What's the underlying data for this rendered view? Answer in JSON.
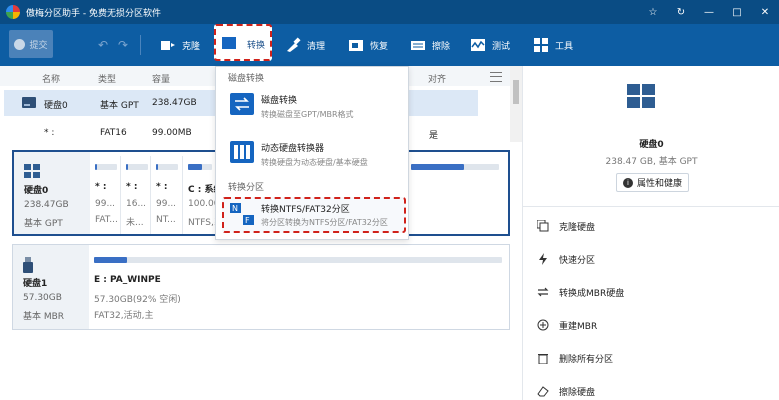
{
  "window": {
    "title": "傲梅分区助手 - 免费无损分区软件",
    "controls": [
      "star-icon",
      "refresh-icon",
      "minimize-icon",
      "maximize-icon",
      "close-icon"
    ]
  },
  "toolbar": {
    "submit": "提交",
    "clone": "克隆",
    "convert": "转换",
    "clean": "清理",
    "restore": "恢复",
    "wipe": "擦除",
    "test": "测试",
    "tools": "工具"
  },
  "table": {
    "headers": [
      "名称",
      "类型",
      "容量",
      "对齐"
    ],
    "rows": [
      {
        "name": "硬盘0",
        "type": "基本 GPT",
        "capacity": "238.47GB",
        "align": ""
      },
      {
        "name": "* :",
        "type": "FAT16",
        "capacity": "99.00MB",
        "align": "是"
      }
    ]
  },
  "disk0": {
    "name": "硬盘0",
    "size": "238.47GB",
    "type": "基本 GPT",
    "partitions": [
      {
        "label": "* :",
        "size": "99...",
        "fs": "FAT...",
        "usage": 0.1
      },
      {
        "label": "* :",
        "size": "16...",
        "fs": "未...",
        "usage": 0.1
      },
      {
        "label": "* :",
        "size": "99...",
        "fs": "NT...",
        "usage": 0.1
      },
      {
        "label": "C : 系统",
        "size": "100.00",
        "fs": "NTFS,系",
        "usage": 0.6
      },
      {
        "label": "",
        "size": "",
        "fs": "",
        "usage": 0.6
      }
    ]
  },
  "disk1": {
    "name": "硬盘1",
    "size": "57.30GB",
    "type": "基本 MBR",
    "partitions": [
      {
        "label": "E : PA_WINPE",
        "size": "57.30GB(92% 空闲)",
        "fs": "FAT32,活动,主",
        "usage": 0.08
      }
    ]
  },
  "dropdown": {
    "section1": "磁盘转换",
    "items1": [
      {
        "title": "磁盘转换",
        "subtitle": "转换磁盘至GPT/MBR格式"
      },
      {
        "title": "动态硬盘转换器",
        "subtitle": "转换硬盘为动态硬盘/基本硬盘"
      }
    ],
    "section2": "转换分区",
    "items2": [
      {
        "title": "转换NTFS/FAT32分区",
        "subtitle": "将分区转换为NTFS分区/FAT32分区"
      }
    ]
  },
  "panel": {
    "disk_name": "硬盘0",
    "disk_desc": "238.47 GB, 基本 GPT",
    "properties_button": "属性和健康",
    "actions": [
      "克隆硬盘",
      "快速分区",
      "转换成MBR硬盘",
      "重建MBR",
      "删除所有分区",
      "擦除硬盘"
    ]
  },
  "colors": {
    "titlebar": "#0a4c84",
    "toolbar": "#0d5da3",
    "accent": "#1e4f8f",
    "highlight_border": "#d0221b",
    "usage_fill": "#3a6fc4"
  }
}
